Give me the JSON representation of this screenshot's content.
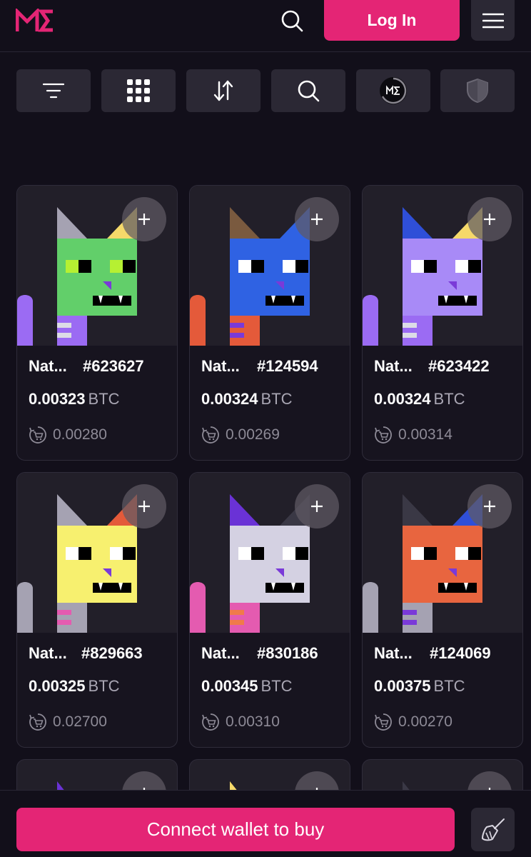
{
  "header": {
    "logo_icon": "magic-eden-logo",
    "search_icon": "search-icon",
    "login_label": "Log In",
    "menu_icon": "hamburger-menu-icon",
    "accent_color": "#e42575"
  },
  "toolbar": {
    "items": [
      {
        "icon": "filter-icon"
      },
      {
        "icon": "grid-view-icon"
      },
      {
        "icon": "sort-icon"
      },
      {
        "icon": "search-icon"
      },
      {
        "icon": "magic-eden-collection-icon"
      },
      {
        "icon": "shield-icon"
      }
    ]
  },
  "cards": [
    {
      "name": "Nat...",
      "number": "#623627",
      "price": "0.00323",
      "unit": "BTC",
      "last_sale": "0.00280",
      "cat_color": "#62cf6a",
      "left_ear": "#a5a2b2",
      "right_ear": "#f5d96a",
      "eye_color": "#b6f032",
      "tail_color": "#9b6bf3",
      "body_color": "#9b6bf3",
      "stripe_color": "#dcdce6"
    },
    {
      "name": "Nat...",
      "number": "#124594",
      "price": "0.00324",
      "unit": "BTC",
      "last_sale": "0.00269",
      "cat_color": "#2f62e3",
      "left_ear": "#7a5a3f",
      "right_ear": "#2f62e3",
      "eye_color": "#ffffff",
      "tail_color": "#e45a3a",
      "body_color": "#e45a3a",
      "stripe_color": "#7a3ad8"
    },
    {
      "name": "Nat...",
      "number": "#623422",
      "price": "0.00324",
      "unit": "BTC",
      "last_sale": "0.00314",
      "cat_color": "#a88af7",
      "left_ear": "#2f4fd8",
      "right_ear": "#f5d96a",
      "eye_color": "#ffffff",
      "tail_color": "#9b6bf3",
      "body_color": "#9b6bf3",
      "stripe_color": "#dcdce6"
    },
    {
      "name": "Nat...",
      "number": "#829663",
      "price": "0.00325",
      "unit": "BTC",
      "last_sale": "0.02700",
      "cat_color": "#f7f06f",
      "left_ear": "#a5a2b2",
      "right_ear": "#e45a3a",
      "eye_color": "#ffffff",
      "tail_color": "#a5a2b2",
      "body_color": "#a5a2b2",
      "stripe_color": "#e45bb0"
    },
    {
      "name": "Nat...",
      "number": "#830186",
      "price": "0.00345",
      "unit": "BTC",
      "last_sale": "0.00310",
      "cat_color": "#d4d1e2",
      "left_ear": "#6a32d6",
      "right_ear": "#3a3845",
      "eye_color": "#ffffff",
      "tail_color": "#e45bb0",
      "body_color": "#e45bb0",
      "stripe_color": "#f07a4a"
    },
    {
      "name": "Nat...",
      "number": "#124069",
      "price": "0.00375",
      "unit": "BTC",
      "last_sale": "0.00270",
      "cat_color": "#e8653f",
      "left_ear": "#3a3845",
      "right_ear": "#2f4fd8",
      "eye_color": "#ffffff",
      "tail_color": "#a5a2b2",
      "body_color": "#a5a2b2",
      "stripe_color": "#7a3ad8"
    }
  ],
  "partial_cards": [
    {
      "ear_color": "#6a32d6"
    },
    {
      "ear_color": "#f5d96a"
    },
    {
      "ear_color": "#3a3845"
    }
  ],
  "bottom": {
    "connect_label": "Connect wallet to buy",
    "broom_icon": "broom-icon"
  }
}
